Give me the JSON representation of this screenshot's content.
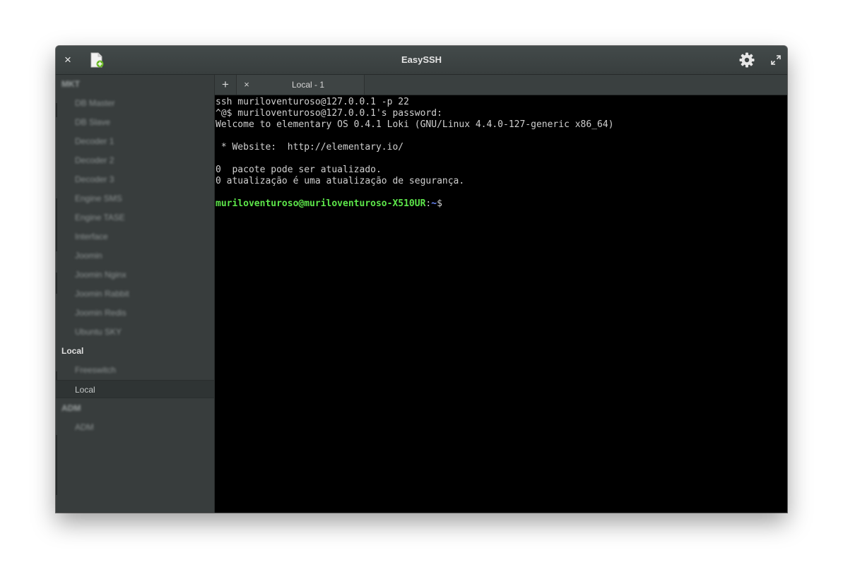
{
  "window": {
    "title": "EasySSH",
    "close_symbol": "×",
    "new_host_icon": "new-file-icon",
    "settings_icon": "gear-icon",
    "maximize_icon": "maximize-icon"
  },
  "sidebar": {
    "groups": [
      {
        "name": "MKT",
        "blurred": true,
        "hosts": [
          "DB Master",
          "DB Slave",
          "Decoder 1",
          "Decoder 2",
          "Decoder 3",
          "Engine SMS",
          "Engine TASE",
          "Interface",
          "Joomin",
          "Joomin Nginx",
          "Joomin Rabbit",
          "Joomin Redis",
          "Ubuntu SKY"
        ]
      },
      {
        "name": "Local",
        "blurred": false,
        "hosts": [
          "Freeswitch",
          "Local"
        ]
      },
      {
        "name": "ADM",
        "blurred": true,
        "hosts": [
          "ADM"
        ]
      }
    ],
    "selected_host": "Local"
  },
  "tabs": {
    "add_symbol": "+",
    "close_symbol": "×",
    "items": [
      {
        "label": "Local - 1",
        "active": true
      }
    ]
  },
  "terminal": {
    "lines": [
      "ssh muriloventuroso@127.0.0.1 -p 22",
      "^@$ muriloventuroso@127.0.0.1's password:",
      "Welcome to elementary OS 0.4.1 Loki (GNU/Linux 4.4.0-127-generic x86_64)",
      "",
      " * Website:  http://elementary.io/",
      "",
      "0  pacote pode ser atualizado.",
      "0 atualização é uma atualização de segurança.",
      ""
    ],
    "prompt": {
      "user_host": "muriloventuroso@muriloventuroso-X510UR",
      "separator": ":",
      "path": "~",
      "symbol": "$"
    }
  },
  "colors": {
    "prompt_user": "#5de64a",
    "prompt_path": "#6d8bff",
    "terminal_bg": "#000000",
    "terminal_fg": "#d0d0d0"
  }
}
